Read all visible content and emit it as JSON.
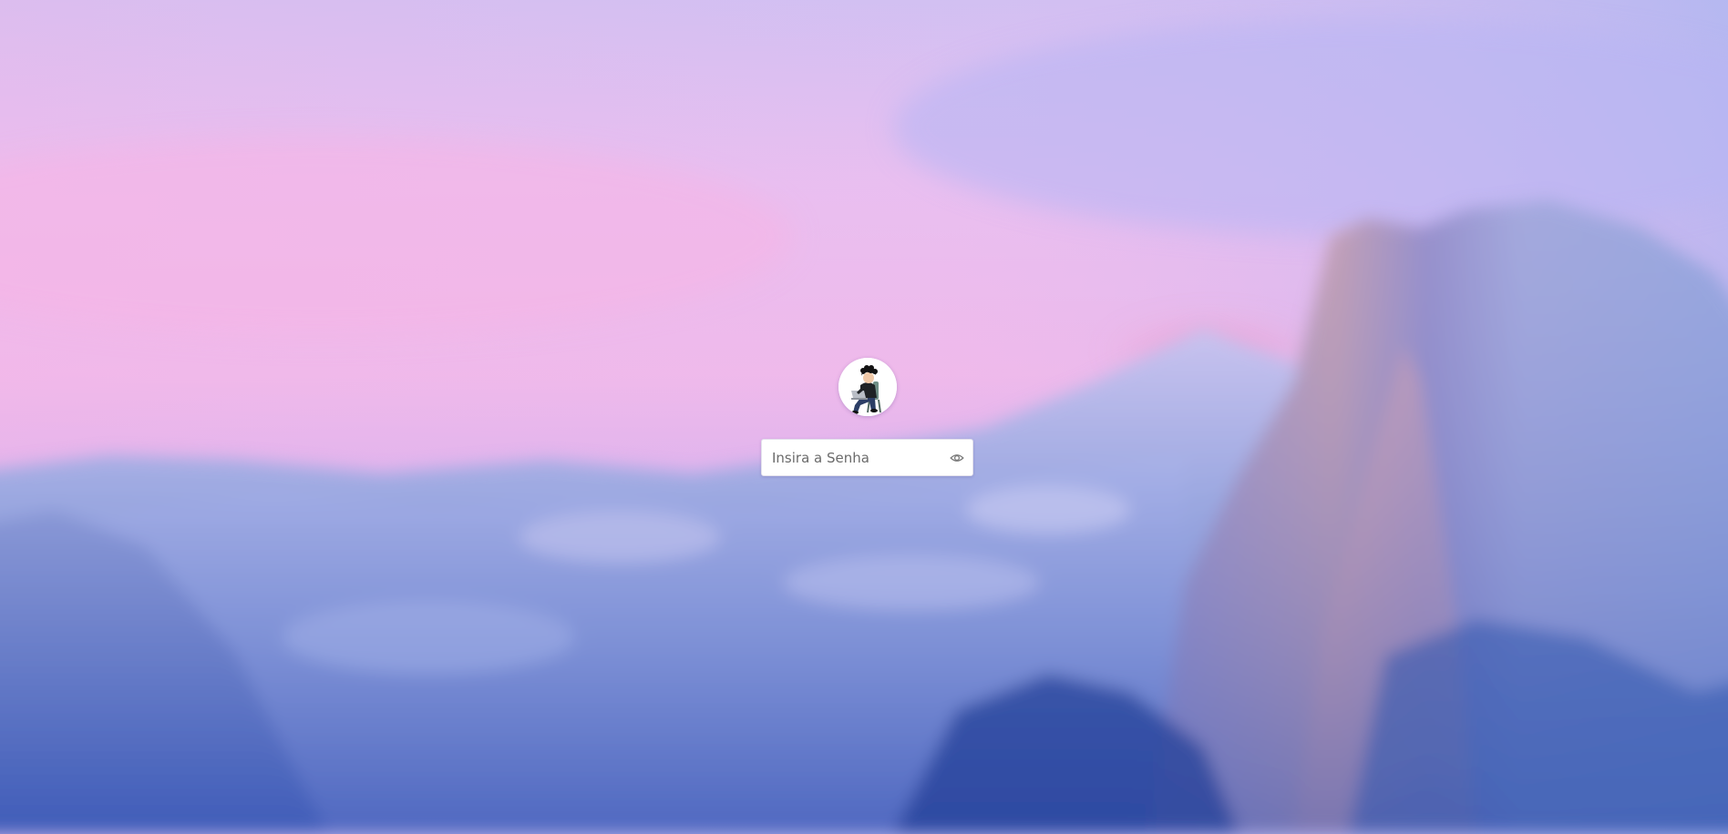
{
  "lock_screen": {
    "password": {
      "placeholder": "Insira a Senha",
      "value": ""
    },
    "reveal_icon": "eye-icon",
    "avatar_icon": "user-avatar"
  },
  "colors": {
    "sky_top": "#c9b6f0",
    "sky_pink": "#f1b6e8",
    "mountain_blue": "#5a74c6",
    "rock_orange": "#d49a9c",
    "field_bg": "#ffffff"
  }
}
